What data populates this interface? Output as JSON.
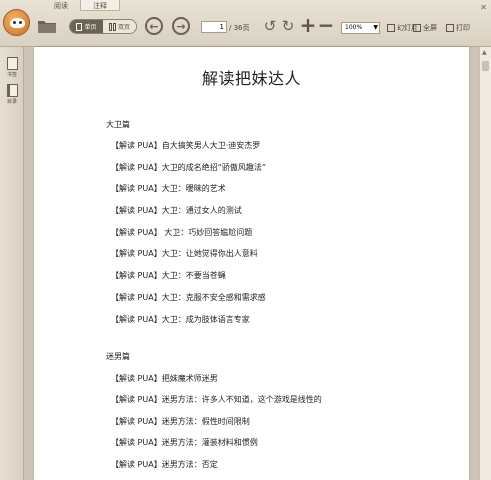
{
  "menu_tabs": [
    "阅读",
    "注释"
  ],
  "toolbar": {
    "single_page": "单页",
    "double_page": "双页",
    "page_current": "1",
    "page_total": "/ 36页",
    "zoom": "100%",
    "slideshow": "幻灯片",
    "fullscreen": "全屏",
    "print": "打印"
  },
  "sidebar": {
    "bookmark": "书签",
    "toc": "目录"
  },
  "document": {
    "title": "解读把妹达人",
    "sections": [
      {
        "heading": "大卫篇",
        "entries": [
          "【解读 PUA】自大搞笑男人大卫·迪安杰罗",
          "【解读 PUA】大卫的成名绝招“骄傲风趣法”",
          "【解读 PUA】大卫：暧昧的艺术",
          "【解读 PUA】大卫：通过女人的测试",
          "【解读 PUA】 大卫：巧妙回答尴尬问题",
          "【解读 PUA】大卫：让她觉得你出人意料",
          "【解读 PUA】大卫：不要当苍蝇",
          "【解读 PUA】大卫：克服不安全感和需求感",
          "【解读 PUA】大卫：成为肢体语言专家"
        ]
      },
      {
        "heading": "迷男篇",
        "entries": [
          "【解读 PUA】把妹魔术师迷男",
          "【解读 PUA】迷男方法：许多人不知道，这个游戏是线性的",
          "【解读 PUA】迷男方法：假性时间限制",
          "【解读 PUA】迷男方法：灌装材料和惯例",
          "【解读 PUA】迷男方法：否定"
        ]
      }
    ]
  },
  "colors": {
    "chrome": "#e2dbcc",
    "page": "#ffffff",
    "text": "#222222"
  },
  "icons": [
    "app-logo-icon",
    "folder-icon",
    "back-icon",
    "forward-icon",
    "rotate-left-icon",
    "rotate-right-icon",
    "zoom-in-icon",
    "zoom-out-icon"
  ]
}
